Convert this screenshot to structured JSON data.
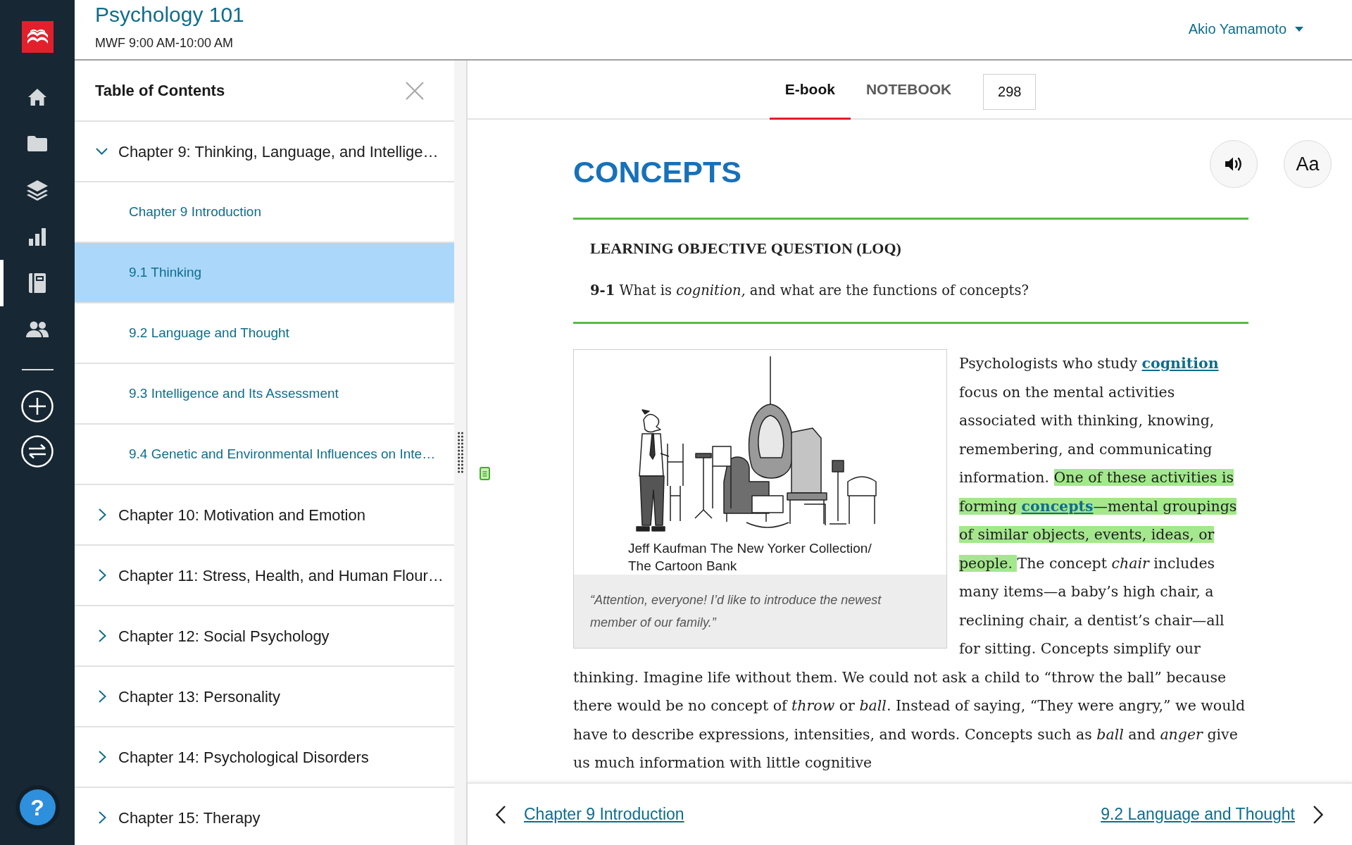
{
  "rail": {
    "nav_items": [
      {
        "kind": "home",
        "selected": false
      },
      {
        "kind": "folder",
        "selected": false
      },
      {
        "kind": "layers",
        "selected": false
      },
      {
        "kind": "chart",
        "selected": false
      },
      {
        "kind": "notebook",
        "selected": true
      },
      {
        "kind": "people",
        "selected": false
      }
    ],
    "action_items": [
      {
        "kind": "add"
      },
      {
        "kind": "swap"
      }
    ],
    "help_button": "?"
  },
  "header": {
    "course_title": "Psychology 101",
    "schedule": "MWF 9:00 AM-10:00 AM",
    "user_menu": "Akio Yamamoto"
  },
  "toc": {
    "title": "Table of Contents",
    "chapters": [
      {
        "label": "Chapter 9: Thinking, Language, and Intellige…",
        "expanded": true,
        "selected": false,
        "children": [
          {
            "label": "Chapter 9 Introduction",
            "selected": false
          },
          {
            "label": "9.1 Thinking",
            "selected": true
          },
          {
            "label": "9.2 Language and Thought",
            "selected": false
          },
          {
            "label": "9.3 Intelligence and Its Assessment",
            "selected": false
          },
          {
            "label": "9.4 Genetic and Environmental Influences on Inte…",
            "selected": false
          }
        ]
      },
      {
        "label": "Chapter 10: Motivation and Emotion",
        "expanded": false,
        "selected": false
      },
      {
        "label": "Chapter 11: Stress, Health, and Human Flour…",
        "expanded": false,
        "selected": false
      },
      {
        "label": "Chapter 12: Social Psychology",
        "expanded": false,
        "selected": false
      },
      {
        "label": "Chapter 13: Personality",
        "expanded": false,
        "selected": false
      },
      {
        "label": "Chapter 14: Psychological Disorders",
        "expanded": false,
        "selected": false
      },
      {
        "label": "Chapter 15: Therapy",
        "expanded": false,
        "selected": false
      }
    ]
  },
  "tabs": [
    {
      "label": "E-book",
      "selected": true
    },
    {
      "label": "NOTEBOOK",
      "selected": false
    }
  ],
  "page_field": {
    "value": "298"
  },
  "reader": {
    "font_button": "Aa",
    "heading": "CONCEPTS",
    "objective": {
      "label": "LEARNING OBJECTIVE QUESTION (LOQ)",
      "question": "**9-1** What is *cognition,* and what are the functions of concepts?"
    },
    "figure": {
      "credit": "Jeff Kaufman The New Yorker Collection/ The Cartoon Bank",
      "caption": "“Attention, everyone! I’d like to introduce the newest member of our family.”"
    },
    "paragraph": [
      {
        "kind": "text",
        "text": "Psychologists who study ",
        "highlighted": false
      },
      {
        "kind": "link",
        "text": "cognition",
        "highlighted": false
      },
      {
        "kind": "text",
        "text": " focus on the mental activities associated with thinking, knowing, remembering, and communicating information. ",
        "highlighted": false
      },
      {
        "kind": "text",
        "text": "One of these activities is forming ",
        "highlighted": true
      },
      {
        "kind": "link",
        "text": "concepts",
        "highlighted": true
      },
      {
        "kind": "text",
        "text": "—mental groupings of similar objects, events, ideas, or people. ",
        "highlighted": true
      },
      {
        "kind": "text",
        "text": "The concept *chair* includes many items—a baby’s high chair, a reclining chair, a dentist’s chair—all for sitting. Concepts simplify our thinking. Imagine life without them. We could not ask a child to “throw the ball” because there would be no concept of *throw* or *ball*. Instead of saying, “They were angry,” we would have to describe expressions, intensities, and words. Concepts such as *ball* and *anger* give us much information with little cognitive",
        "highlighted": false
      }
    ]
  },
  "footer_nav": {
    "previous": "Chapter 9 Introduction",
    "next": "9.2 Language and Thought"
  }
}
